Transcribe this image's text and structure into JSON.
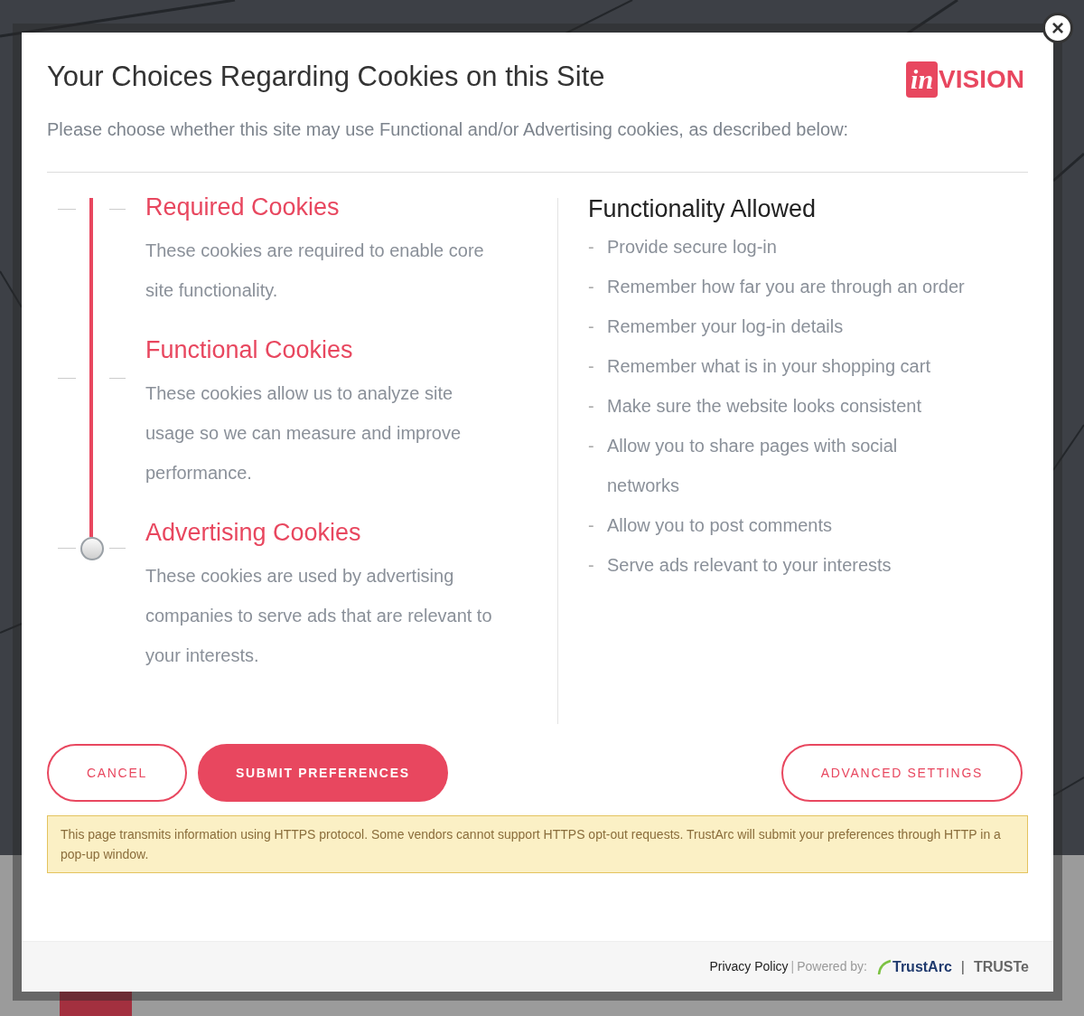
{
  "dialog": {
    "title": "Your Choices Regarding Cookies on this Site",
    "subtitle": "Please choose whether this site may use Functional and/or Advertising cookies, as described below:",
    "logo": {
      "mark": "in",
      "word": "VISION"
    },
    "close": "×"
  },
  "cookie_levels": [
    {
      "title": "Required Cookies",
      "description": "These cookies are required to enable core site functionality.",
      "selected": false
    },
    {
      "title": "Functional Cookies",
      "description": "These cookies allow us to analyze site usage so we can measure and improve performance.",
      "selected": false
    },
    {
      "title": "Advertising Cookies",
      "description": "These cookies are used by advertising companies to serve ads that are relevant to your interests.",
      "selected": true
    }
  ],
  "functionality": {
    "heading": "Functionality Allowed",
    "bullet": "-",
    "items": [
      "Provide secure log-in",
      "Remember how far you are through an order",
      "Remember your log-in details",
      "Remember what is in your shopping cart",
      "Make sure the website looks consistent",
      "Allow you to share pages with social networks",
      "Allow you to post comments",
      "Serve ads relevant to your interests"
    ]
  },
  "buttons": [
    {
      "label": "CANCEL",
      "kind": "outline"
    },
    {
      "label": "SUBMIT PREFERENCES",
      "kind": "filled"
    },
    {
      "label": "ADVANCED SETTINGS",
      "kind": "outline"
    }
  ],
  "notice": "This page transmits information using HTTPS protocol. Some vendors cannot support HTTPS opt-out requests. TrustArc will submit your preferences through HTTP in a pop-up window.",
  "footer": {
    "privacy": "Privacy Policy",
    "separator": "|",
    "powered": "Powered by:",
    "brand": "TrustArc",
    "divider": "|",
    "brand2": "TRUSTe"
  }
}
